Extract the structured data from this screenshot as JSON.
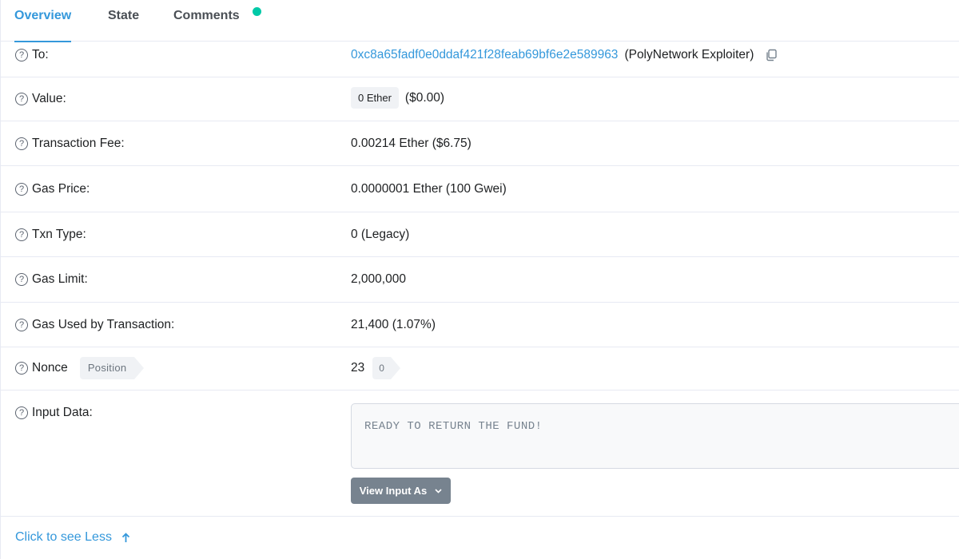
{
  "tabs": [
    {
      "label": "Overview",
      "active": true
    },
    {
      "label": "State",
      "active": false
    },
    {
      "label": "Comments",
      "active": false,
      "has_dot": true
    }
  ],
  "rows": {
    "to": {
      "label": "To:",
      "address": "0xc8a65fadf0e0ddaf421f28feab69bf6e2e589963",
      "name": "(PolyNetwork Exploiter)"
    },
    "value": {
      "label": "Value:",
      "badge": "0 Ether",
      "usd": "($0.00)"
    },
    "fee": {
      "label": "Transaction Fee:",
      "value": "0.00214 Ether ($6.75)"
    },
    "gas_price": {
      "label": "Gas Price:",
      "value": "0.0000001 Ether (100 Gwei)"
    },
    "txn_type": {
      "label": "Txn Type:",
      "value": "0 (Legacy)"
    },
    "gas_limit": {
      "label": "Gas Limit:",
      "value": "2,000,000"
    },
    "gas_used": {
      "label": "Gas Used by Transaction:",
      "value": "21,400 (1.07%)"
    },
    "nonce": {
      "label": "Nonce",
      "position_badge": "Position",
      "value": "23",
      "position_value": "0"
    },
    "input": {
      "label": "Input Data:",
      "text": "READY TO RETURN THE FUND!",
      "view_button": "View Input As"
    }
  },
  "footer": {
    "see_less": "Click to see Less"
  },
  "colors": {
    "accent": "#3498db",
    "dot": "#00c9a7",
    "button": "#77838f"
  }
}
